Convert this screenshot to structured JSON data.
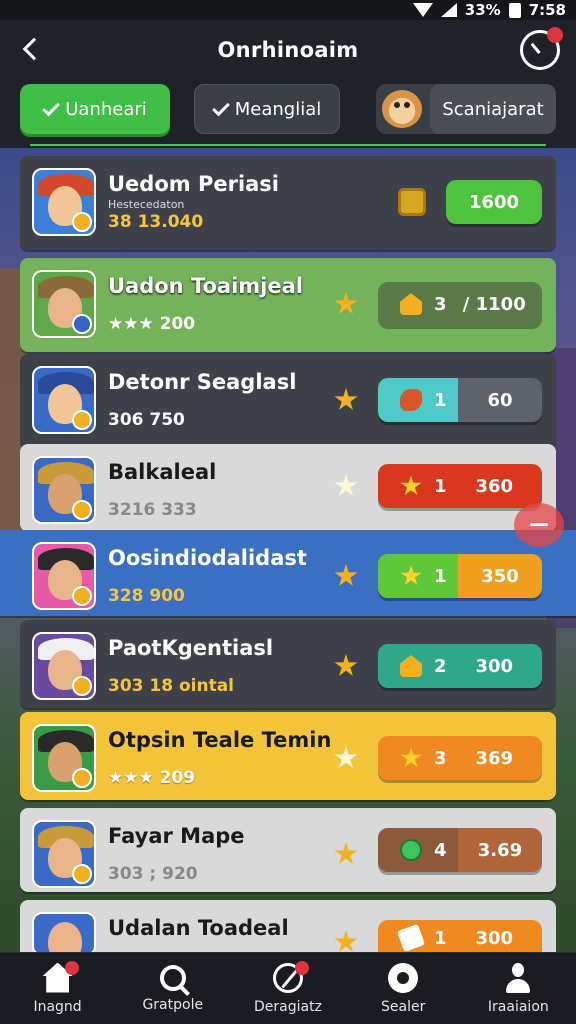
{
  "status_bar": {
    "battery": "33%",
    "time": "7:58"
  },
  "header": {
    "title": "Onrhinoaim"
  },
  "filters": {
    "tab1": "Uanheari",
    "tab2": "Meanglial",
    "tab3": "Scaniajarat"
  },
  "rows": [
    {
      "name": "Uedom Periasi",
      "tag": "Hestecedaton",
      "sub": "38 13.040",
      "value": "1600",
      "bg": "#3e4149",
      "btn_style": "green-solid"
    },
    {
      "name": "Uadon Toaimjeal",
      "sub": "★★★ 200",
      "value_left": "3",
      "value": "/ 1100",
      "bg": "#74b35a",
      "btn_style": "olive"
    },
    {
      "name": "Detonr Seaglasl",
      "sub": "306 750",
      "value_left": "1",
      "value": "60",
      "bg": "#3e4149",
      "btn_style": "teal-grey"
    },
    {
      "name": "Balkaleal",
      "sub": "3216 333",
      "value_left": "1",
      "value": "360",
      "bg": "#d9d9d9",
      "btn_style": "red"
    },
    {
      "name": "Oosindiodalidast",
      "sub": "328 900",
      "value_left": "1",
      "value": "350",
      "bg": "#3b6fc2",
      "btn_style": "green-orange"
    },
    {
      "name": "PaotKgentiasl",
      "sub": "303 18 ointal",
      "value_left": "2",
      "value": "300",
      "bg": "#3e4149",
      "btn_style": "teal"
    },
    {
      "name": "Otpsin Teale Temin",
      "sub": "★★★ 209",
      "value_left": "3",
      "value": "369",
      "bg": "#f3c43a",
      "btn_style": "orange"
    },
    {
      "name": "Fayar Mape",
      "sub": "303 ; 920",
      "value_left": "4",
      "value": "3.69",
      "bg": "#d9d9d9",
      "btn_style": "brown"
    },
    {
      "name": "Udalan Toadeal",
      "sub": "",
      "value_left": "1",
      "value": "300",
      "bg": "#d9d9d9",
      "btn_style": "orange"
    }
  ],
  "bottom_nav": [
    {
      "label": "Inagnd",
      "icon": "home-icon"
    },
    {
      "label": "Gratpole",
      "icon": "search-icon"
    },
    {
      "label": "Deragiatz",
      "icon": "compass-icon"
    },
    {
      "label": "Sealer",
      "icon": "gear-icon"
    },
    {
      "label": "Iraaiaion",
      "icon": "user-icon"
    }
  ]
}
